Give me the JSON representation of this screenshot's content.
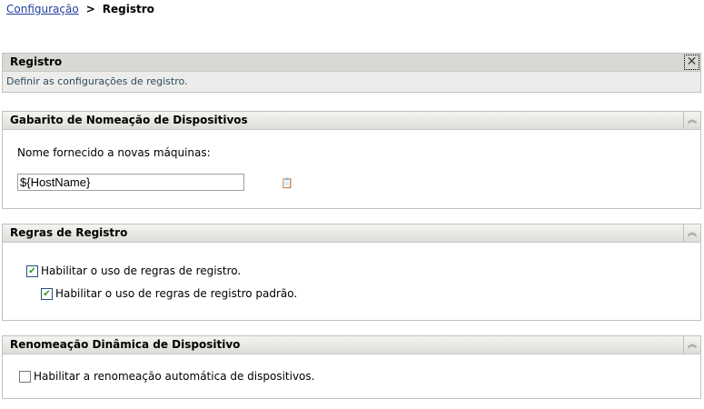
{
  "breadcrumb": {
    "parent": "Configuração",
    "separator": ">",
    "current": "Registro"
  },
  "intro": {
    "title": "Registro",
    "description": "Definir as configurações de registro."
  },
  "naming": {
    "title": "Gabarito de Nomeação de Dispositivos",
    "label": "Nome fornecido a novas máquinas:",
    "value": "${HostName}"
  },
  "rules": {
    "title": "Regras de Registro",
    "enable": {
      "label": "Habilitar o uso de regras de registro.",
      "checked": true
    },
    "enable_default": {
      "label": "Habilitar o uso de regras de registro padrão.",
      "checked": true
    }
  },
  "rename": {
    "title": "Renomeação Dinâmica de Dispositivo",
    "enable": {
      "label": "Habilitar a renomeação automática de dispositivos.",
      "checked": false
    }
  }
}
